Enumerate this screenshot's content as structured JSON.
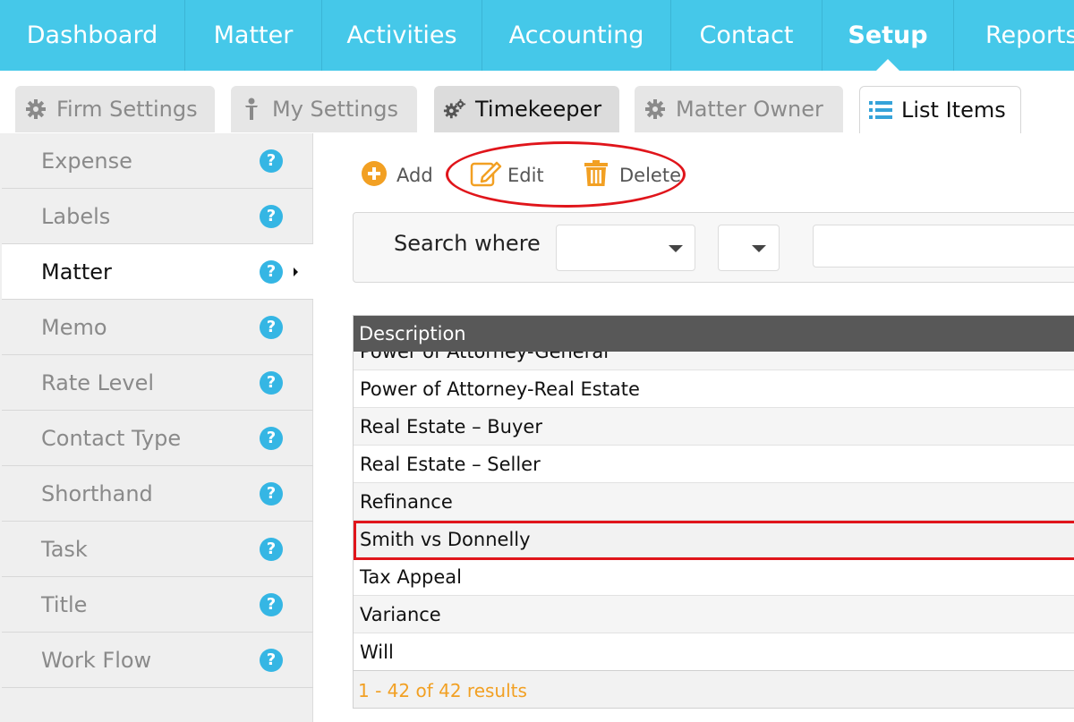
{
  "topnav": {
    "items": [
      {
        "label": "Dashboard"
      },
      {
        "label": "Matter"
      },
      {
        "label": "Activities"
      },
      {
        "label": "Accounting"
      },
      {
        "label": "Contact"
      },
      {
        "label": "Setup",
        "active": true
      },
      {
        "label": "Reports"
      }
    ]
  },
  "tabs": [
    {
      "label": "Firm Settings",
      "icon": "gear-icon"
    },
    {
      "label": "My Settings",
      "icon": "person-icon"
    },
    {
      "label": "Timekeeper",
      "icon": "gears-icon"
    },
    {
      "label": "Matter Owner",
      "icon": "gear-icon"
    },
    {
      "label": "List Items",
      "icon": "list-icon",
      "active": true
    }
  ],
  "sidebar": {
    "items": [
      {
        "label": "Expense"
      },
      {
        "label": "Labels"
      },
      {
        "label": "Matter",
        "active": true
      },
      {
        "label": "Memo"
      },
      {
        "label": "Rate Level"
      },
      {
        "label": "Contact Type"
      },
      {
        "label": "Shorthand"
      },
      {
        "label": "Task"
      },
      {
        "label": "Title"
      },
      {
        "label": "Work Flow"
      }
    ],
    "help_glyph": "?"
  },
  "toolbar": {
    "add_label": "Add",
    "edit_label": "Edit",
    "delete_label": "Delete"
  },
  "search": {
    "label": "Search where",
    "field_value": "",
    "operator_value": "",
    "query_value": ""
  },
  "grid": {
    "column_header": "Description",
    "rows": [
      "Power of Attorney-General",
      "Power of Attorney-Real Estate",
      "Real Estate – Buyer",
      "Real Estate – Seller",
      "Refinance",
      "Smith vs Donnelly",
      "Tax Appeal",
      "Variance",
      "Will"
    ],
    "selected_row": "Smith vs Donnelly",
    "footer": "1 - 42 of 42 results"
  },
  "colors": {
    "nav_bg": "#45c8e9",
    "accent_orange": "#f2a023",
    "help_blue": "#35b6e4",
    "highlight_red": "#e0151b",
    "header_dark": "#585858"
  }
}
